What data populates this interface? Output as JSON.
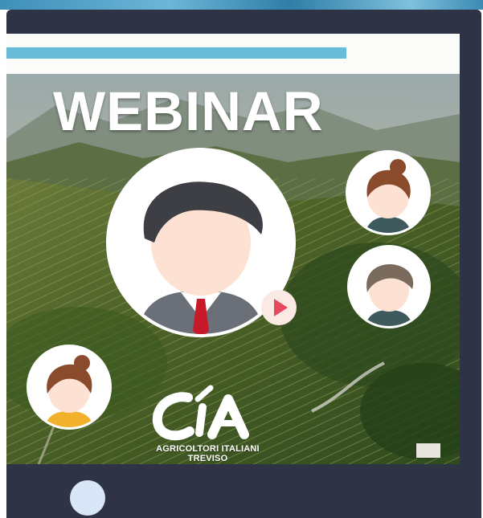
{
  "banner": {
    "title": "WEBINAR",
    "progress_percent": 75
  },
  "logo": {
    "mark": "cia",
    "line1": "AGRICOLTORI ITALIANI",
    "line2": "TREVISO"
  },
  "icons": {
    "presenter": "presenter-avatar-icon",
    "participants": [
      "participant-woman-icon",
      "participant-man-icon",
      "participant-girl-icon"
    ],
    "play": "play-icon"
  },
  "colors": {
    "progress": "#69bcd8",
    "frame": "#2e3446",
    "play": "#e8485f",
    "tie": "#c8192b"
  }
}
